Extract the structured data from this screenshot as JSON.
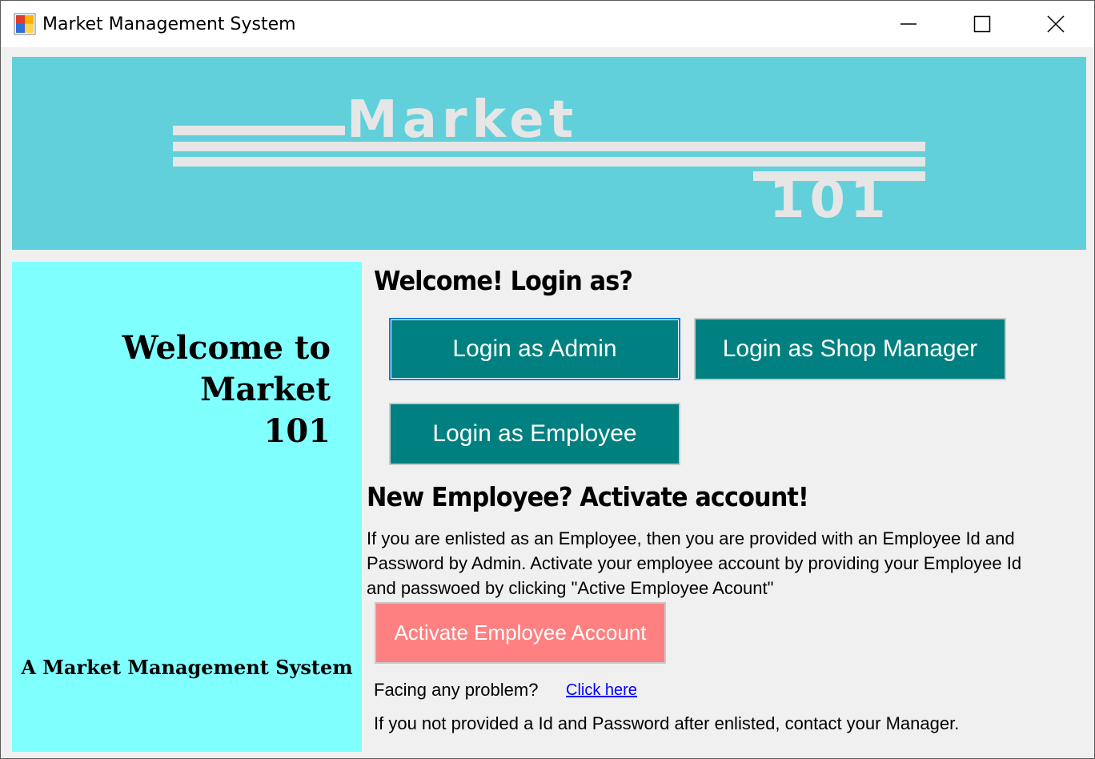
{
  "window": {
    "title": "Market Management System"
  },
  "banner": {
    "logo_word": "Market",
    "logo_number": "101",
    "background": "#62d0da"
  },
  "left_panel": {
    "welcome_line1": "Welcome to Market",
    "welcome_line2": "101",
    "tagline": "A Market Management System",
    "background": "#80ffff"
  },
  "main": {
    "login_heading": "Welcome! Login as?",
    "login_admin_label": "Login as Admin",
    "login_manager_label": "Login as Shop Manager",
    "login_employee_label": "Login as Employee",
    "new_employee_heading": "New Employee? Activate account!",
    "info_line1": "If you are enlisted as an Employee, then you are provided with an Employee Id and",
    "info_line2": "Password by Admin. Activate your employee account by providing your Employee Id",
    "info_line3": "and passwoed by clicking \"Active Employee Acount\"",
    "activate_label": "Activate Employee Account",
    "problem_text": "Facing any problem?",
    "problem_link": "Click here",
    "contact_text": "If you not provided a Id and Password after enlisted, contact your Manager."
  },
  "colors": {
    "button_teal": "#008080",
    "button_pink": "#ff8080",
    "link": "#0000ff"
  },
  "icons": {
    "app": "app-icon",
    "minimize": "minimize-icon",
    "maximize": "maximize-icon",
    "close": "close-icon"
  }
}
